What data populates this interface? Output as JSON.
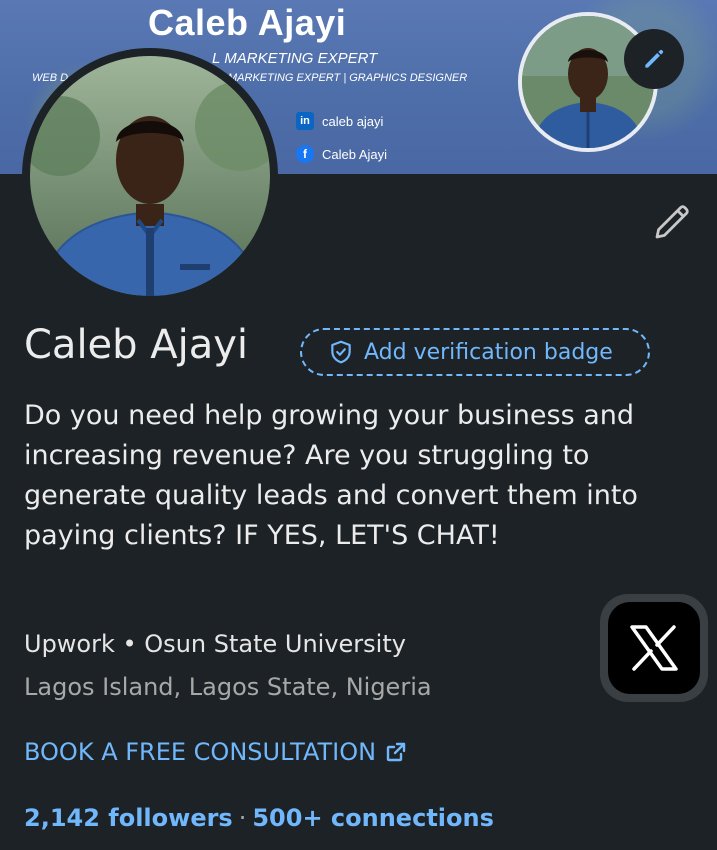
{
  "banner": {
    "title": "Caleb Ajayi",
    "subtitle": "L MARKETING EXPERT",
    "tagline_left": "WEB D",
    "tagline_right": "MARKETING EXPERT | GRAPHICS DESIGNER",
    "linkedin_handle": "caleb ajayi",
    "facebook_handle": "Caleb Ajayi"
  },
  "profile": {
    "name": "Caleb Ajayi",
    "verification_label": "Add verification badge",
    "headline": "Do you need help growing your business and increasing revenue? Are you struggling to generate quality leads and convert them into paying clients? IF YES, LET'S CHAT!",
    "company_line": "Upwork • Osun State University",
    "location": "Lagos Island, Lagos State, Nigeria",
    "custom_button": "BOOK A FREE CONSULTATION",
    "followers": "2,142 followers",
    "separator": "·",
    "connections": "500+ connections"
  },
  "colors": {
    "background": "#1d2226",
    "link": "#71b7fb",
    "banner": "#4e6ea9"
  },
  "icons": {
    "verify": "shield-check-icon",
    "external": "external-link-icon",
    "edit": "pencil-icon",
    "x": "x-logo-icon"
  }
}
